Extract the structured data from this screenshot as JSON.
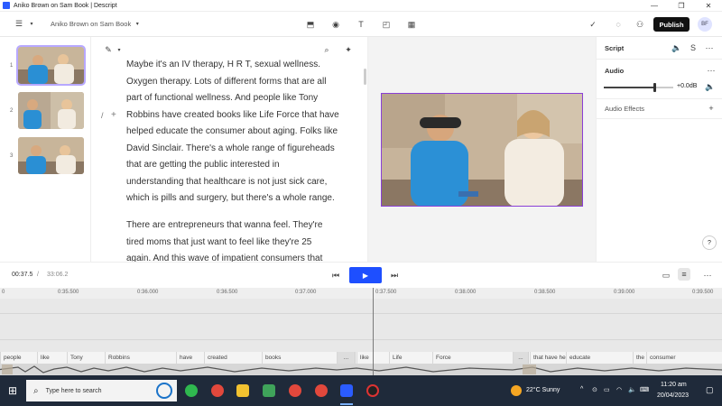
{
  "window": {
    "title": "Aniko Brown on Sam Book | Descript",
    "controls": [
      "—",
      "❐",
      "✕"
    ]
  },
  "toolbar": {
    "project_name": "Aniko Brown on Sam Book",
    "publish_label": "Publish",
    "avatar_initials": "BF"
  },
  "thumbnails": [
    {
      "number": "1",
      "selected": true
    },
    {
      "number": "2",
      "selected": false
    },
    {
      "number": "3",
      "selected": false
    }
  ],
  "script": {
    "para1_lines": [
      "Maybe it's an IV therapy, H R T, sexual wellness.",
      "Oxygen therapy. Lots of different forms that are all",
      "part of functional wellness. And people like Tony",
      "Robbins have created books like Life Force that have",
      "helped educate the consumer about aging. Folks like",
      "David Sinclair. There's a whole range of figureheads",
      "that are getting the public interested in",
      "understanding that healthcare is not just sick care,",
      "which is pills and surgery, but there's a whole range."
    ],
    "para2_lines": [
      "There are entrepreneurs that wanna feel. They're",
      "tired moms that just want to feel like they're 25",
      "again. And this wave of impatient consumers that"
    ]
  },
  "right_panel": {
    "script_label": "Script",
    "audio_label": "Audio",
    "gain_value": "+0.0dB",
    "audio_effects_label": "Audio Effects",
    "help_label": "?"
  },
  "transport": {
    "current_time": "00:37.5",
    "total_time": "33:06.2"
  },
  "timeline": {
    "ticks": [
      {
        "label": "0"
      },
      {
        "label": "0:35.500"
      },
      {
        "label": "0:36.000"
      },
      {
        "label": "0:36.500"
      },
      {
        "label": "0:37.000"
      },
      {
        "label": "0:37.500"
      },
      {
        "label": "0:38.000"
      },
      {
        "label": "0:38.500"
      },
      {
        "label": "0:39.000"
      },
      {
        "label": "0:39.500"
      }
    ],
    "words": [
      {
        "text": "people"
      },
      {
        "text": "like"
      },
      {
        "text": "Tony"
      },
      {
        "text": "Robbins"
      },
      {
        "text": "have"
      },
      {
        "text": "created"
      },
      {
        "text": "books"
      },
      {
        "text": "..."
      },
      {
        "text": "like"
      },
      {
        "text": "Life"
      },
      {
        "text": "Force"
      },
      {
        "text": "..."
      },
      {
        "text": "that have he"
      },
      {
        "text": "educate"
      },
      {
        "text": "the"
      },
      {
        "text": "consumer"
      }
    ]
  },
  "taskbar": {
    "search_placeholder": "Type here to search",
    "weather": "22°C  Sunny",
    "time": "11:20 am",
    "date": "20/04/2023"
  },
  "colors": {
    "accent": "#1e4fff",
    "video_border": "#8a3fd6",
    "taskbar": "#1f2a3a"
  }
}
